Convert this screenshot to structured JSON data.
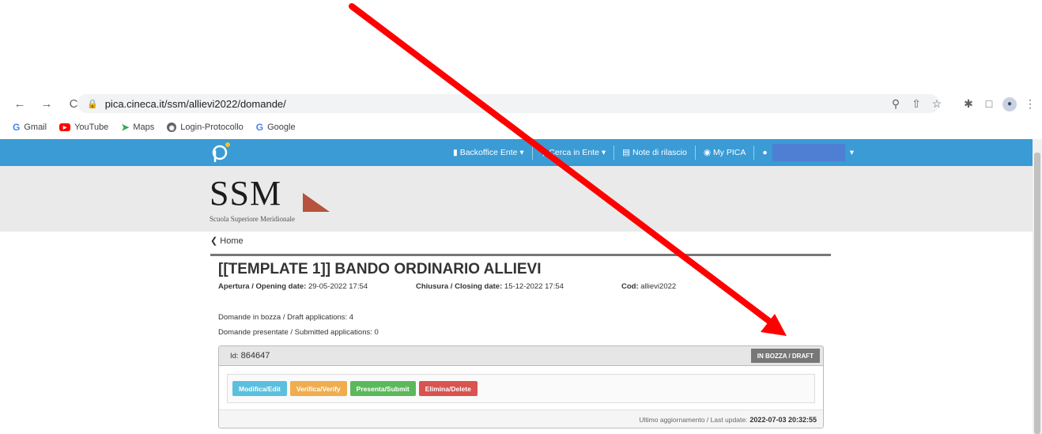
{
  "browser": {
    "url": "pica.cineca.it/ssm/allievi2022/domande/",
    "nav": {
      "back": "←",
      "forward": "→",
      "reload": "C"
    },
    "toolbar_icons": [
      "zoom-icon",
      "share-icon",
      "star-icon",
      "extensions-icon",
      "sidebar-icon",
      "profile-icon",
      "menu-icon"
    ],
    "bookmarks": [
      {
        "label": "Gmail",
        "icon": "gmail-icon"
      },
      {
        "label": "YouTube",
        "icon": "youtube-icon"
      },
      {
        "label": "Maps",
        "icon": "maps-icon"
      },
      {
        "label": "Login-Protocollo",
        "icon": "globe-icon"
      },
      {
        "label": "Google",
        "icon": "google-icon"
      }
    ]
  },
  "topnav": {
    "backoffice": "Backoffice Ente",
    "cerca": "Cerca in Ente",
    "note": "Note di rilascio",
    "mypica": "My PICA"
  },
  "header": {
    "logo_text": "SSM",
    "logo_subtitle": "Scuola Superiore Meridionale"
  },
  "page": {
    "home_link": "Home",
    "title": "[[TEMPLATE 1]] BANDO ORDINARIO ALLIEVI",
    "opening_label": "Apertura / Opening date:",
    "opening_value": "29-05-2022 17:54",
    "closing_label": "Chiusura / Closing date:",
    "closing_value": "15-12-2022 17:54",
    "cod_label": "Cod:",
    "cod_value": "allievi2022",
    "drafts": "Domande in bozza / Draft applications: 4",
    "submitted": "Domande presentate / Submitted applications: 0"
  },
  "application": {
    "id_label": "Id:",
    "id_value": "864647",
    "status": "IN BOZZA / DRAFT",
    "buttons": {
      "edit": "Modifica/Edit",
      "verify": "Verifica/Verify",
      "submit": "Presenta/Submit",
      "delete": "Elimina/Delete"
    },
    "last_update_label": "Ultimo aggiornamento / Last update:",
    "last_update_value": "2022-07-03 20:32:55"
  },
  "colors": {
    "navbar": "#3a9bd5",
    "annotation_arrow": "#ff0000",
    "draft_badge": "#777777"
  }
}
